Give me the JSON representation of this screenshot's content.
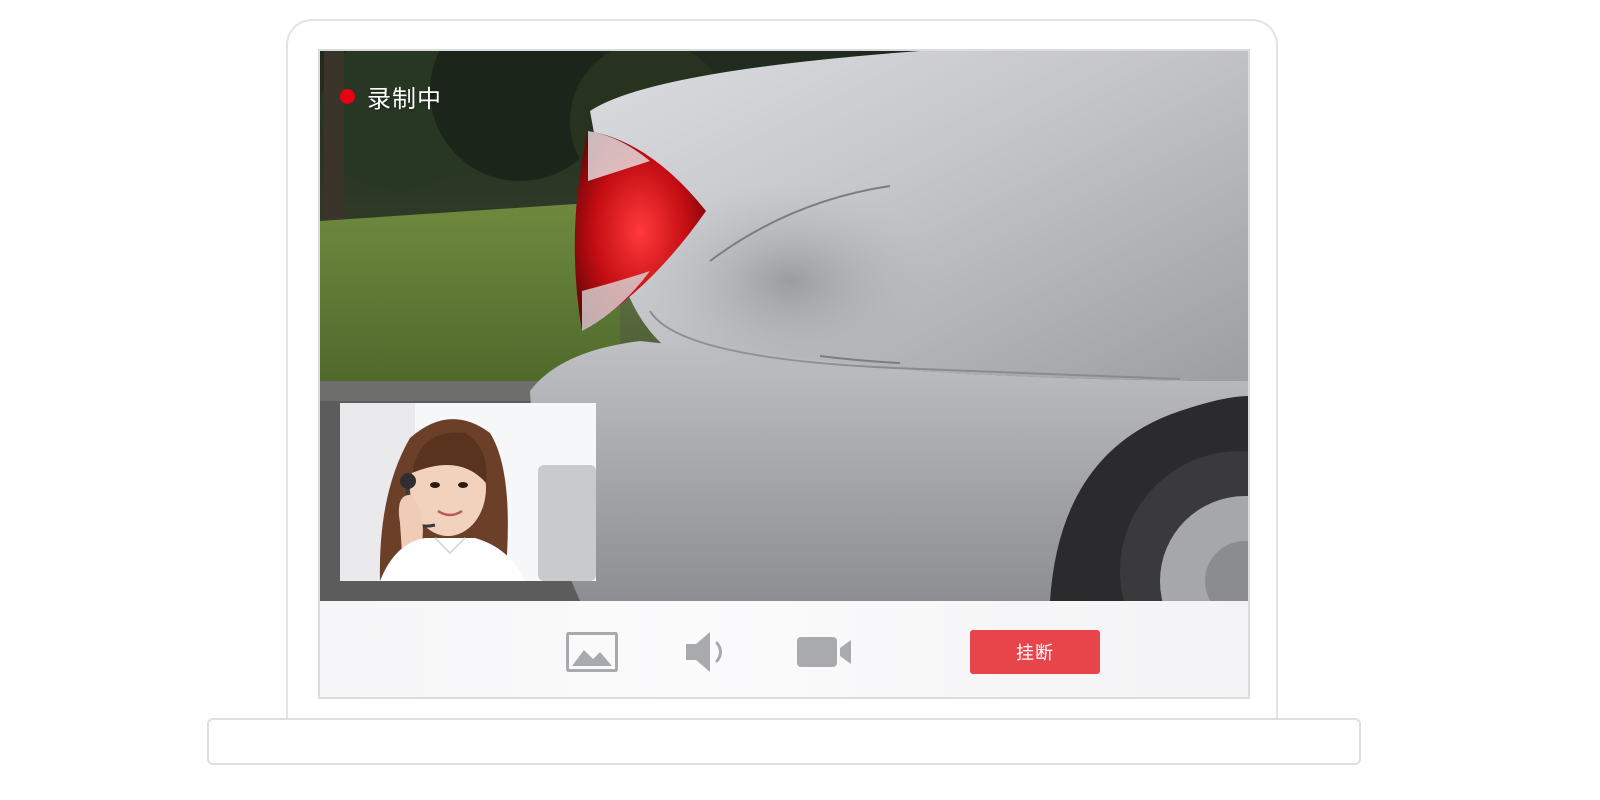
{
  "recording": {
    "label": "录制中",
    "dot_color": "#e60012"
  },
  "controls": {
    "image_icon": "image-icon",
    "audio_icon": "speaker-icon",
    "video_icon": "camera-icon",
    "hangup_label": "挂断",
    "hangup_color": "#e8454b",
    "icon_color": "#a9aaae"
  }
}
